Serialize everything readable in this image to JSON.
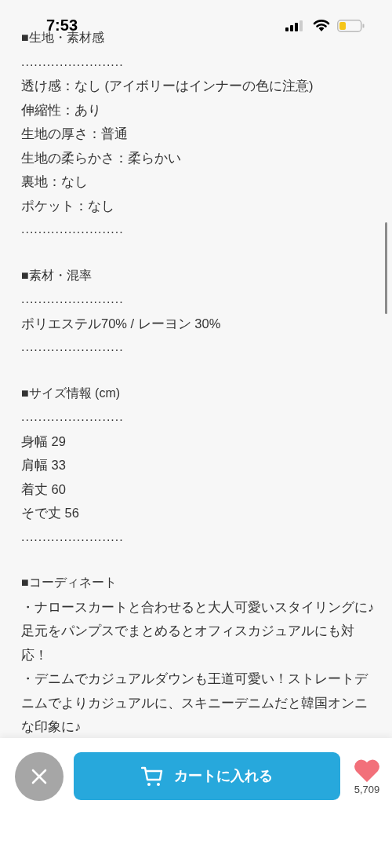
{
  "status_bar": {
    "time": "7:53"
  },
  "sections": [
    {
      "heading": "■生地・素材感",
      "lines": [
        {
          "kind": "dots",
          "text": "........................"
        },
        {
          "kind": "text",
          "text": "透け感：なし (アイボリーはインナーの色に注意)"
        },
        {
          "kind": "text",
          "text": "伸縮性：あり"
        },
        {
          "kind": "text",
          "text": "生地の厚さ：普通"
        },
        {
          "kind": "text",
          "text": "生地の柔らかさ：柔らかい"
        },
        {
          "kind": "text",
          "text": "裏地：なし"
        },
        {
          "kind": "text",
          "text": "ポケット：なし"
        },
        {
          "kind": "dots",
          "text": "........................"
        }
      ]
    },
    {
      "heading": "■素材・混率",
      "lines": [
        {
          "kind": "dots",
          "text": "........................"
        },
        {
          "kind": "text",
          "text": "ポリエステル70% / レーヨン 30%"
        },
        {
          "kind": "dots",
          "text": "........................"
        }
      ]
    },
    {
      "heading": "■サイズ情報 (cm)",
      "lines": [
        {
          "kind": "dots",
          "text": "........................"
        },
        {
          "kind": "text",
          "text": "身幅 29"
        },
        {
          "kind": "text",
          "text": "肩幅 33"
        },
        {
          "kind": "text",
          "text": "着丈 60"
        },
        {
          "kind": "text",
          "text": "そで丈 56"
        },
        {
          "kind": "dots",
          "text": "........................"
        }
      ]
    },
    {
      "heading": "■コーディネート",
      "lines": [
        {
          "kind": "text",
          "text": "・ナロースカートと合わせると大人可愛いスタイリングに♪足元をパンプスでまとめるとオフィスカジュアルにも対応！"
        },
        {
          "kind": "text",
          "text": "・デニムでカジュアルダウンも王道可愛い！ストレートデニムでよりカジュアルに、スキニーデニムだと韓国オンニな印象に♪"
        }
      ]
    }
  ],
  "bottom_bar": {
    "add_to_cart": "カートに入れる",
    "like_count": "5,709"
  }
}
